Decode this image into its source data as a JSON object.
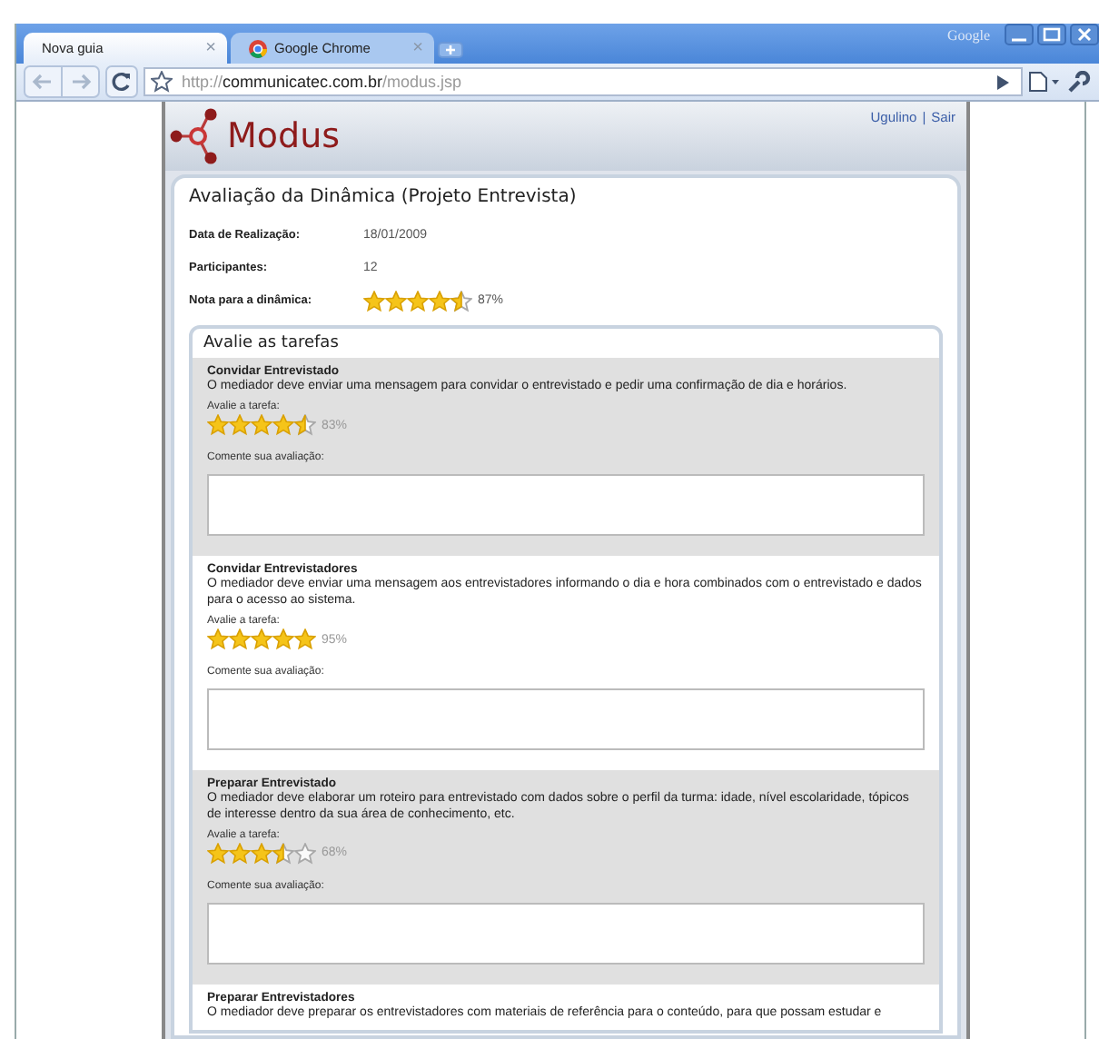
{
  "browser": {
    "brand": "Google",
    "tabs": [
      {
        "label": "Nova guia",
        "selected": true,
        "close": "×"
      },
      {
        "label": "Google Chrome",
        "selected": false,
        "close": "×"
      }
    ],
    "address": {
      "scheme": "http://",
      "host": "communicatec.com.br",
      "path": "/modus.jsp"
    }
  },
  "header": {
    "logo": "Modus",
    "user_links": [
      {
        "label": "Ugulino"
      },
      {
        "label": "Sair"
      }
    ],
    "separator": "|"
  },
  "page": {
    "title": "Avaliação da Dinâmica (Projeto Entrevista)",
    "fields": [
      {
        "label": "Data de Realização:",
        "value": "18/01/2009"
      },
      {
        "label": "Participantes:",
        "value": "12"
      },
      {
        "label": "Nota para a dinâmica:",
        "kind": "rating",
        "stars": 4.5,
        "value": "87%"
      }
    ],
    "tasks_title": "Avalie as tarefas",
    "tasks": [
      {
        "title": "Convidar Entrevistado",
        "description": "O mediador deve enviar uma mensagem para convidar o entrevistado e pedir uma confirmação de dia e horários.",
        "rating_label": "Avalie a tarefa:",
        "stars": 4.5,
        "percent": "83%",
        "comment_label": "Comente sua avaliação:"
      },
      {
        "title": "Convidar Entrevistadores",
        "description": "O mediador deve enviar uma mensagem aos entrevistadores informando o dia e hora combinados com o entrevistado e dados para o acesso ao sistema.",
        "rating_label": "Avalie a tarefa:",
        "stars": 5,
        "percent": "95%",
        "comment_label": "Comente sua avaliação:"
      },
      {
        "title": "Preparar Entrevistado",
        "description": "O mediador deve elaborar um roteiro para entrevistado com dados sobre o perfil da turma: idade, nível escolaridade, tópicos de interesse dentro da sua área de conhecimento, etc.",
        "rating_label": "Avalie a tarefa:",
        "stars": 3.5,
        "percent": "68%",
        "comment_label": "Comente sua avaliação:"
      },
      {
        "title": "Preparar Entrevistadores",
        "description": "O mediador deve preparar os entrevistadores com materiais de referência para o conteúdo, para que possam estudar e"
      }
    ]
  }
}
